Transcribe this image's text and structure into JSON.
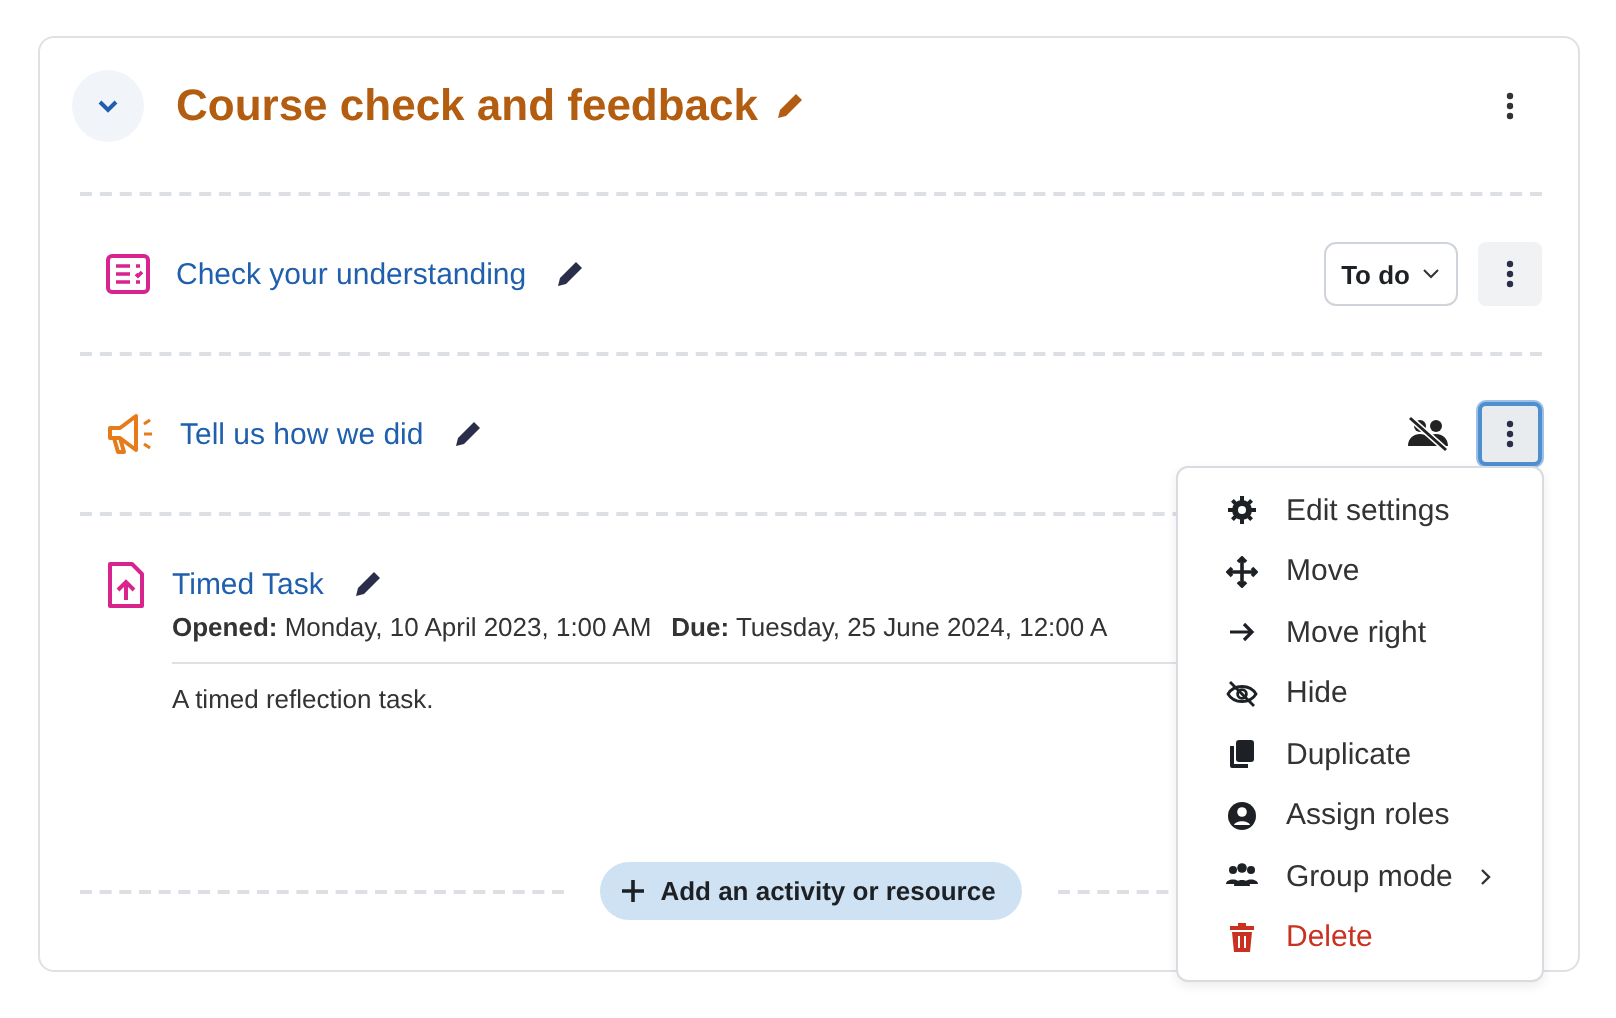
{
  "section": {
    "title": "Course check and feedback",
    "expanded": true
  },
  "activities": [
    {
      "kind": "quiz",
      "name": "Check your understanding",
      "completion": "To do",
      "groups": false,
      "menu_focused": false
    },
    {
      "kind": "announce",
      "name": "Tell us how we did",
      "groups": true,
      "menu_focused": true
    },
    {
      "kind": "assign",
      "name": "Timed Task",
      "dates": [
        {
          "label": "Opened:",
          "value": "Monday, 10 April 2023, 1:00 AM"
        },
        {
          "label": "Due:",
          "value": "Tuesday, 25 June 2024, 12:00 A"
        }
      ],
      "description": "A timed reflection task."
    }
  ],
  "add_button": "Add an activity or resource",
  "menu": [
    {
      "kind": "gear",
      "label": "Edit settings"
    },
    {
      "kind": "move",
      "label": "Move"
    },
    {
      "kind": "arrow",
      "label": "Move right"
    },
    {
      "kind": "hide",
      "label": "Hide"
    },
    {
      "kind": "copy",
      "label": "Duplicate"
    },
    {
      "kind": "user",
      "label": "Assign roles"
    },
    {
      "kind": "users",
      "label": "Group mode",
      "submenu": true
    },
    {
      "kind": "trash",
      "label": "Delete",
      "danger": true
    }
  ]
}
